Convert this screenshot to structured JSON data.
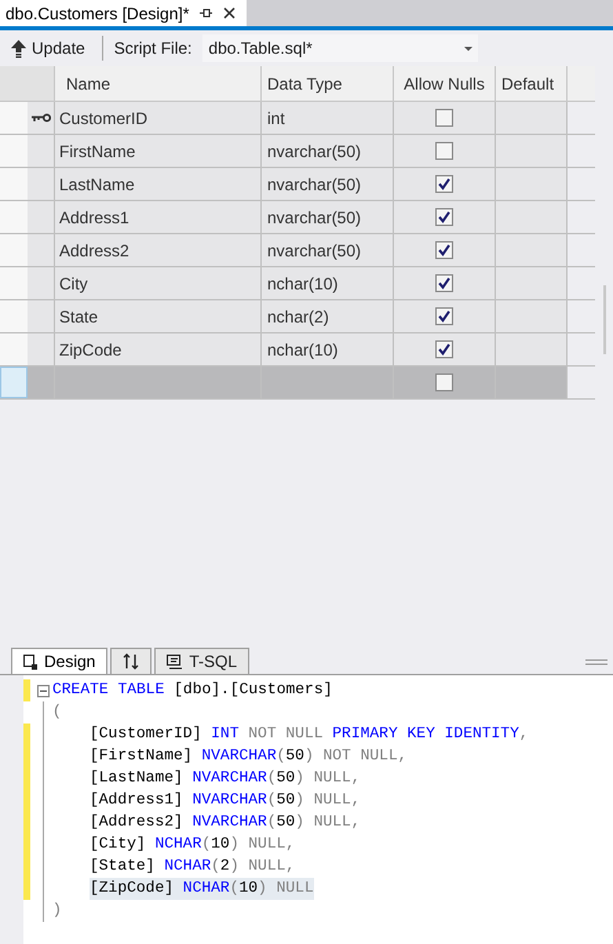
{
  "document_tab": {
    "title": "dbo.Customers [Design]*",
    "selected": true
  },
  "toolbar": {
    "update_button": "Update",
    "script_file_label": "Script File:",
    "script_file_value": "dbo.Table.sql*"
  },
  "table": {
    "columns": [
      "Name",
      "Data Type",
      "Allow Nulls",
      "Default"
    ],
    "rows": [
      {
        "kind": "column",
        "primary_key": true,
        "name": "CustomerID",
        "data_type": "int",
        "allow_nulls": false
      },
      {
        "kind": "column",
        "primary_key": false,
        "name": "FirstName",
        "data_type": "nvarchar(50)",
        "allow_nulls": false
      },
      {
        "kind": "column",
        "primary_key": false,
        "name": "LastName",
        "data_type": "nvarchar(50)",
        "allow_nulls": true
      },
      {
        "kind": "column",
        "primary_key": false,
        "name": "Address1",
        "data_type": "nvarchar(50)",
        "allow_nulls": true
      },
      {
        "kind": "column",
        "primary_key": false,
        "name": "Address2",
        "data_type": "nvarchar(50)",
        "allow_nulls": true
      },
      {
        "kind": "column",
        "primary_key": false,
        "name": "City",
        "data_type": "nchar(10)",
        "allow_nulls": true
      },
      {
        "kind": "column",
        "primary_key": false,
        "name": "State",
        "data_type": "nchar(2)",
        "allow_nulls": true
      },
      {
        "kind": "column",
        "primary_key": false,
        "name": "ZipCode",
        "data_type": "nchar(10)",
        "allow_nulls": true
      },
      {
        "kind": "new",
        "primary_key": false,
        "allow_nulls": false
      }
    ]
  },
  "pane_tabs": [
    {
      "kind": "design",
      "label": "Design",
      "selected": true
    },
    {
      "kind": "swap",
      "selected": false
    },
    {
      "kind": "tsql",
      "label": "T-SQL",
      "selected": false
    }
  ],
  "code": [
    {
      "changed": true,
      "kind": "top",
      "fold": true,
      "highlighted": false,
      "tokens": [
        {
          "kind": "kw",
          "text": "CREATE TABLE"
        },
        {
          "kind": "plain",
          "text": " [dbo].[Customers]"
        }
      ]
    },
    {
      "changed": false,
      "kind": "top",
      "fold": false,
      "highlighted": false,
      "tokens": [
        {
          "kind": "gray",
          "text": "("
        }
      ]
    },
    {
      "changed": true,
      "kind": "body",
      "fold": false,
      "highlighted": false,
      "tokens": [
        {
          "kind": "plain",
          "text": "[CustomerID] "
        },
        {
          "kind": "kw",
          "text": "INT "
        },
        {
          "kind": "gray",
          "text": "NOT NULL "
        },
        {
          "kind": "kw",
          "text": "PRIMARY KEY IDENTITY"
        },
        {
          "kind": "gray",
          "text": ","
        }
      ]
    },
    {
      "changed": true,
      "kind": "body",
      "fold": false,
      "highlighted": false,
      "tokens": [
        {
          "kind": "plain",
          "text": "[FirstName] "
        },
        {
          "kind": "kw",
          "text": "NVARCHAR"
        },
        {
          "kind": "gray",
          "text": "("
        },
        {
          "kind": "plain",
          "text": "50"
        },
        {
          "kind": "gray",
          "text": ") NOT NULL,"
        }
      ]
    },
    {
      "changed": true,
      "kind": "body",
      "fold": false,
      "highlighted": false,
      "tokens": [
        {
          "kind": "plain",
          "text": "[LastName] "
        },
        {
          "kind": "kw",
          "text": "NVARCHAR"
        },
        {
          "kind": "gray",
          "text": "("
        },
        {
          "kind": "plain",
          "text": "50"
        },
        {
          "kind": "gray",
          "text": ") NULL,"
        }
      ]
    },
    {
      "changed": true,
      "kind": "body",
      "fold": false,
      "highlighted": false,
      "tokens": [
        {
          "kind": "plain",
          "text": "[Address1] "
        },
        {
          "kind": "kw",
          "text": "NVARCHAR"
        },
        {
          "kind": "gray",
          "text": "("
        },
        {
          "kind": "plain",
          "text": "50"
        },
        {
          "kind": "gray",
          "text": ") NULL,"
        }
      ]
    },
    {
      "changed": true,
      "kind": "body",
      "fold": false,
      "highlighted": false,
      "tokens": [
        {
          "kind": "plain",
          "text": "[Address2] "
        },
        {
          "kind": "kw",
          "text": "NVARCHAR"
        },
        {
          "kind": "gray",
          "text": "("
        },
        {
          "kind": "plain",
          "text": "50"
        },
        {
          "kind": "gray",
          "text": ") NULL,"
        }
      ]
    },
    {
      "changed": true,
      "kind": "body",
      "fold": false,
      "highlighted": false,
      "tokens": [
        {
          "kind": "plain",
          "text": "[City] "
        },
        {
          "kind": "kw",
          "text": "NCHAR"
        },
        {
          "kind": "gray",
          "text": "("
        },
        {
          "kind": "plain",
          "text": "10"
        },
        {
          "kind": "gray",
          "text": ") NULL,"
        }
      ]
    },
    {
      "changed": true,
      "kind": "body",
      "fold": false,
      "highlighted": false,
      "tokens": [
        {
          "kind": "plain",
          "text": "[State] "
        },
        {
          "kind": "kw",
          "text": "NCHAR"
        },
        {
          "kind": "gray",
          "text": "("
        },
        {
          "kind": "plain",
          "text": "2"
        },
        {
          "kind": "gray",
          "text": ") NULL,"
        }
      ]
    },
    {
      "changed": true,
      "kind": "body",
      "fold": false,
      "highlighted": true,
      "tokens": [
        {
          "kind": "plain",
          "text": "[ZipCode] "
        },
        {
          "kind": "kw",
          "text": "NCHAR"
        },
        {
          "kind": "gray",
          "text": "("
        },
        {
          "kind": "plain",
          "text": "10"
        },
        {
          "kind": "gray",
          "text": ") NULL"
        }
      ]
    },
    {
      "changed": false,
      "kind": "top",
      "fold": false,
      "highlighted": false,
      "tokens": [
        {
          "kind": "gray",
          "text": ")"
        }
      ]
    }
  ]
}
